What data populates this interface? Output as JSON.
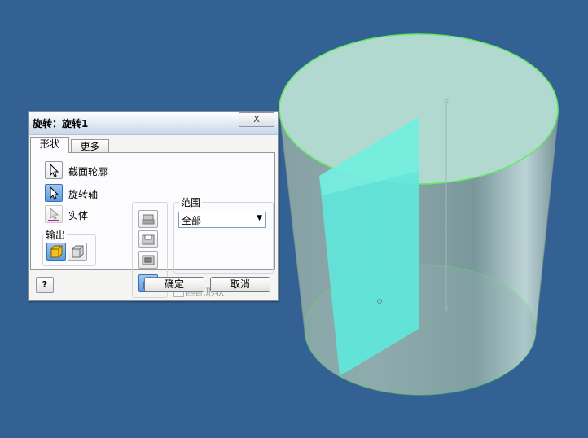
{
  "dialog": {
    "title": "旋转：旋转1",
    "close_label": "X",
    "tabs": [
      {
        "label": "形状",
        "active": true
      },
      {
        "label": "更多",
        "active": false
      }
    ],
    "selectors": {
      "profile_label": "截面轮廓",
      "axis_label": "旋转轴",
      "solid_label": "实体"
    },
    "output_label": "输出",
    "range": {
      "label": "范围",
      "value": "全部"
    },
    "match_shape_label": "匹配形状",
    "buttons": {
      "help": "?",
      "ok": "确定",
      "cancel": "取消"
    }
  },
  "viewport": {
    "background": "#336194",
    "cylinder_edge_color": "#5fee5f",
    "profile_fill": "#5ee8dc"
  }
}
